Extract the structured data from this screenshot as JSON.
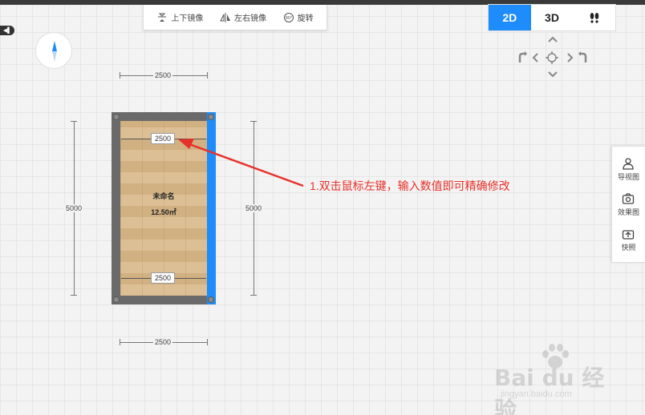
{
  "toolbar": {
    "mirror_vertical": "上下镜像",
    "mirror_horizontal": "左右镜像",
    "rotate": "旋转",
    "rotate_badge": "90°"
  },
  "view_switch": {
    "view_2d": "2D",
    "view_3d": "3D",
    "active": "2D",
    "accent_color": "#1e8cfa"
  },
  "nav_pad": {
    "up": "⌃",
    "down": "⌄",
    "left": "‹",
    "right": "›",
    "center_icon": "crosshair-icon",
    "rotate_left_icon": "rotate-left-icon",
    "rotate_right_icon": "rotate-right-icon"
  },
  "side_panel": {
    "items": [
      {
        "label": "导视图",
        "icon": "person-icon"
      },
      {
        "label": "效果图",
        "icon": "camera-icon"
      },
      {
        "label": "快照",
        "icon": "snapshot-icon"
      }
    ]
  },
  "dimensions": {
    "top_outer": "2500",
    "bottom_outer": "2500",
    "left_outer": "5000",
    "right_outer": "5000",
    "top_inner_input": "2500",
    "bottom_inner_input": "2500"
  },
  "room": {
    "name": "未命名",
    "area": "12.50㎡"
  },
  "annotation": {
    "text": "1.双击鼠标左键，输入数值即可精确修改",
    "color": "#e8302a"
  },
  "watermark": {
    "brand": "Bai du 经验",
    "url": "jingyan.baidu.com"
  }
}
